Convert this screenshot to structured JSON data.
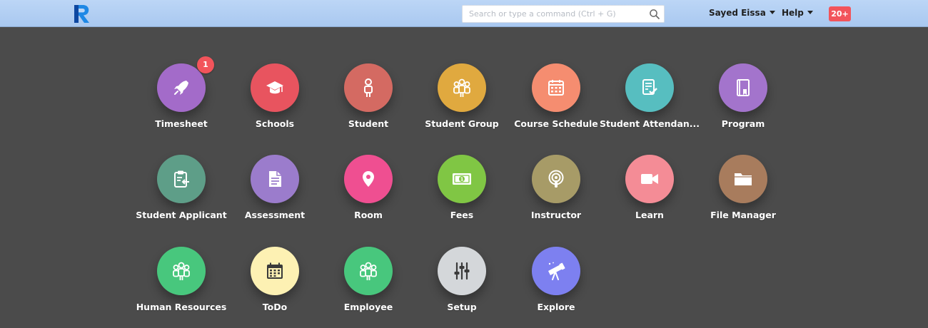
{
  "navbar": {
    "search_placeholder": "Search or type a command (Ctrl + G)",
    "user_menu": "Sayed Eissa",
    "help_menu": "Help",
    "notifications": "20+"
  },
  "colors": {
    "navbar": "#b3cff3",
    "background": "#4b4b4b",
    "badge": "#f2545b"
  },
  "modules": [
    {
      "label": "Timesheet",
      "icon": "rocket-icon",
      "color": "#a36bc9",
      "badge": "1"
    },
    {
      "label": "Schools",
      "icon": "graduation-cap-icon",
      "color": "#e8545f"
    },
    {
      "label": "Student",
      "icon": "student-icon",
      "color": "#d46a62"
    },
    {
      "label": "Student Group",
      "icon": "group-icon",
      "color": "#e0a93f"
    },
    {
      "label": "Course Schedule",
      "icon": "calendar-icon",
      "color": "#f58d70"
    },
    {
      "label": "Student Attendan...",
      "icon": "attendance-icon",
      "color": "#57bec0"
    },
    {
      "label": "Program",
      "icon": "book-icon",
      "color": "#a374cc"
    },
    {
      "label": "Student Applicant",
      "icon": "clipboard-icon",
      "color": "#5e9e88"
    },
    {
      "label": "Assessment",
      "icon": "document-icon",
      "color": "#9b7ccc"
    },
    {
      "label": "Room",
      "icon": "map-pin-icon",
      "color": "#ef4f91"
    },
    {
      "label": "Fees",
      "icon": "banknote-icon",
      "color": "#80c644"
    },
    {
      "label": "Instructor",
      "icon": "podcast-icon",
      "color": "#a79b67"
    },
    {
      "label": "Learn",
      "icon": "video-camera-icon",
      "color": "#f48c96"
    },
    {
      "label": "File Manager",
      "icon": "folder-icon",
      "color": "#a87c5d"
    },
    {
      "label": "Human Resources",
      "icon": "people-icon",
      "color": "#48c77d"
    },
    {
      "label": "ToDo",
      "icon": "calendar-grid-icon",
      "color": "#fdf1b3"
    },
    {
      "label": "Employee",
      "icon": "employees-icon",
      "color": "#48c77d"
    },
    {
      "label": "Setup",
      "icon": "sliders-icon",
      "color": "#d4d7da"
    },
    {
      "label": "Explore",
      "icon": "telescope-icon",
      "color": "#7d80f0"
    }
  ]
}
